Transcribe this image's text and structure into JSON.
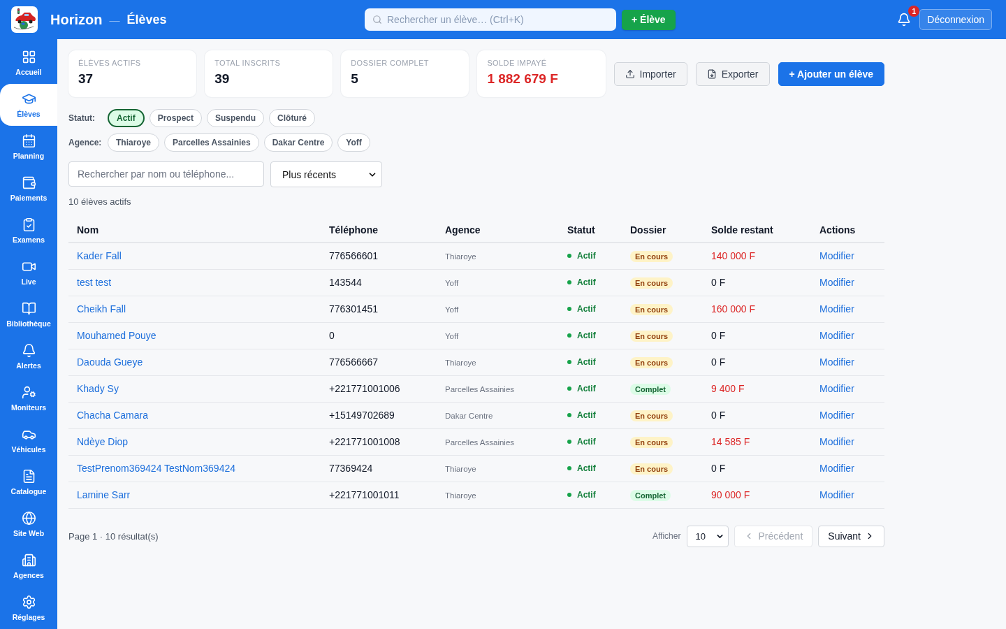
{
  "header": {
    "app_name": "Horizon",
    "separator": "—",
    "page_title": "Élèves",
    "search": {
      "placeholder": "Rechercher un élève… (Ctrl+K)"
    },
    "add_button": "+ Élève",
    "notifications": {
      "count": "1"
    },
    "logout_button": "Déconnexion"
  },
  "sidebar": {
    "items": [
      {
        "label": "Accueil",
        "selected": false
      },
      {
        "label": "Élèves",
        "selected": true
      },
      {
        "label": "Planning",
        "selected": false
      },
      {
        "label": "Paiements",
        "selected": false
      },
      {
        "label": "Examens",
        "selected": false
      },
      {
        "label": "Live",
        "selected": false
      },
      {
        "label": "Bibliothèque",
        "selected": false
      },
      {
        "label": "Alertes",
        "selected": false
      },
      {
        "label": "Moniteurs",
        "selected": false
      },
      {
        "label": "Véhicules",
        "selected": false
      },
      {
        "label": "Catalogue",
        "selected": false
      },
      {
        "label": "Site Web",
        "selected": false
      },
      {
        "label": "Agences",
        "selected": false
      },
      {
        "label": "Réglages",
        "selected": false
      }
    ]
  },
  "stats": [
    {
      "label": "ÉLÈVES ACTIFS",
      "value": "37",
      "alert": false
    },
    {
      "label": "TOTAL INSCRITS",
      "value": "39",
      "alert": false
    },
    {
      "label": "DOSSIER COMPLET",
      "value": "5",
      "alert": false
    },
    {
      "label": "SOLDE IMPAYÉ",
      "value": "1 882 679 F",
      "alert": true
    }
  ],
  "actions": [
    {
      "label": "Importer",
      "kind": "import"
    },
    {
      "label": "Exporter",
      "kind": "export"
    },
    {
      "label": "+ Ajouter un élève",
      "kind": "primary"
    }
  ],
  "filters": [
    {
      "label": "Statut:",
      "chips": [
        {
          "label": "Actif",
          "selected": true
        },
        {
          "label": "Prospect",
          "selected": false
        },
        {
          "label": "Suspendu",
          "selected": false
        },
        {
          "label": "Clôturé",
          "selected": false
        }
      ]
    },
    {
      "label": "Agence:",
      "chips": [
        {
          "label": "Thiaroye",
          "selected": false
        },
        {
          "label": "Parcelles Assainies",
          "selected": false
        },
        {
          "label": "Dakar Centre",
          "selected": false
        },
        {
          "label": "Yoff",
          "selected": false
        }
      ]
    }
  ],
  "search": {
    "placeholder": "Rechercher par nom ou téléphone..."
  },
  "sort": {
    "value": "Plus récents"
  },
  "result_count": "10 élèves actifs",
  "table": {
    "columns": [
      "Nom",
      "Téléphone",
      "Agence",
      "Statut",
      "Dossier",
      "Solde restant",
      "Actions"
    ],
    "rows": [
      {
        "name": "Kader Fall",
        "phone": "776566601",
        "agency": "Thiaroye",
        "status": "Actif",
        "dossier": {
          "label": "En cours",
          "kind": "pending"
        },
        "balance": {
          "amount": "140 000 F",
          "due": true
        },
        "action": "Modifier"
      },
      {
        "name": "test test",
        "phone": "143544",
        "agency": "Yoff",
        "status": "Actif",
        "dossier": {
          "label": "En cours",
          "kind": "pending"
        },
        "balance": {
          "amount": "0 F",
          "due": false
        },
        "action": "Modifier"
      },
      {
        "name": "Cheikh Fall",
        "phone": "776301451",
        "agency": "Yoff",
        "status": "Actif",
        "dossier": {
          "label": "En cours",
          "kind": "pending"
        },
        "balance": {
          "amount": "160 000 F",
          "due": true
        },
        "action": "Modifier"
      },
      {
        "name": "Mouhamed Pouye",
        "phone": "0",
        "agency": "Yoff",
        "status": "Actif",
        "dossier": {
          "label": "En cours",
          "kind": "pending"
        },
        "balance": {
          "amount": "0 F",
          "due": false
        },
        "action": "Modifier"
      },
      {
        "name": "Daouda Gueye",
        "phone": "776566667",
        "agency": "Thiaroye",
        "status": "Actif",
        "dossier": {
          "label": "En cours",
          "kind": "pending"
        },
        "balance": {
          "amount": "0 F",
          "due": false
        },
        "action": "Modifier"
      },
      {
        "name": "Khady Sy",
        "phone": "+221771001006",
        "agency": "Parcelles Assainies",
        "status": "Actif",
        "dossier": {
          "label": "Complet",
          "kind": "complete"
        },
        "balance": {
          "amount": "9 400 F",
          "due": true
        },
        "action": "Modifier"
      },
      {
        "name": "Chacha Camara",
        "phone": "+15149702689",
        "agency": "Dakar Centre",
        "status": "Actif",
        "dossier": {
          "label": "En cours",
          "kind": "pending"
        },
        "balance": {
          "amount": "0 F",
          "due": false
        },
        "action": "Modifier"
      },
      {
        "name": "Ndèye Diop",
        "phone": "+221771001008",
        "agency": "Parcelles Assainies",
        "status": "Actif",
        "dossier": {
          "label": "En cours",
          "kind": "pending"
        },
        "balance": {
          "amount": "14 585 F",
          "due": true
        },
        "action": "Modifier"
      },
      {
        "name": "TestPrenom369424 TestNom369424",
        "phone": "77369424",
        "agency": "Thiaroye",
        "status": "Actif",
        "dossier": {
          "label": "En cours",
          "kind": "pending"
        },
        "balance": {
          "amount": "0 F",
          "due": false
        },
        "action": "Modifier"
      },
      {
        "name": "Lamine Sarr",
        "phone": "+221771001011",
        "agency": "Thiaroye",
        "status": "Actif",
        "dossier": {
          "label": "Complet",
          "kind": "complete"
        },
        "balance": {
          "amount": "90 000 F",
          "due": true
        },
        "action": "Modifier"
      }
    ]
  },
  "pagination": {
    "summary": "Page 1 · 10 résultat(s)",
    "page_size_label": "Afficher",
    "page_size": "10",
    "previous": {
      "label": "Précédent",
      "disabled": true
    },
    "next": {
      "label": "Suivant",
      "disabled": false
    }
  }
}
